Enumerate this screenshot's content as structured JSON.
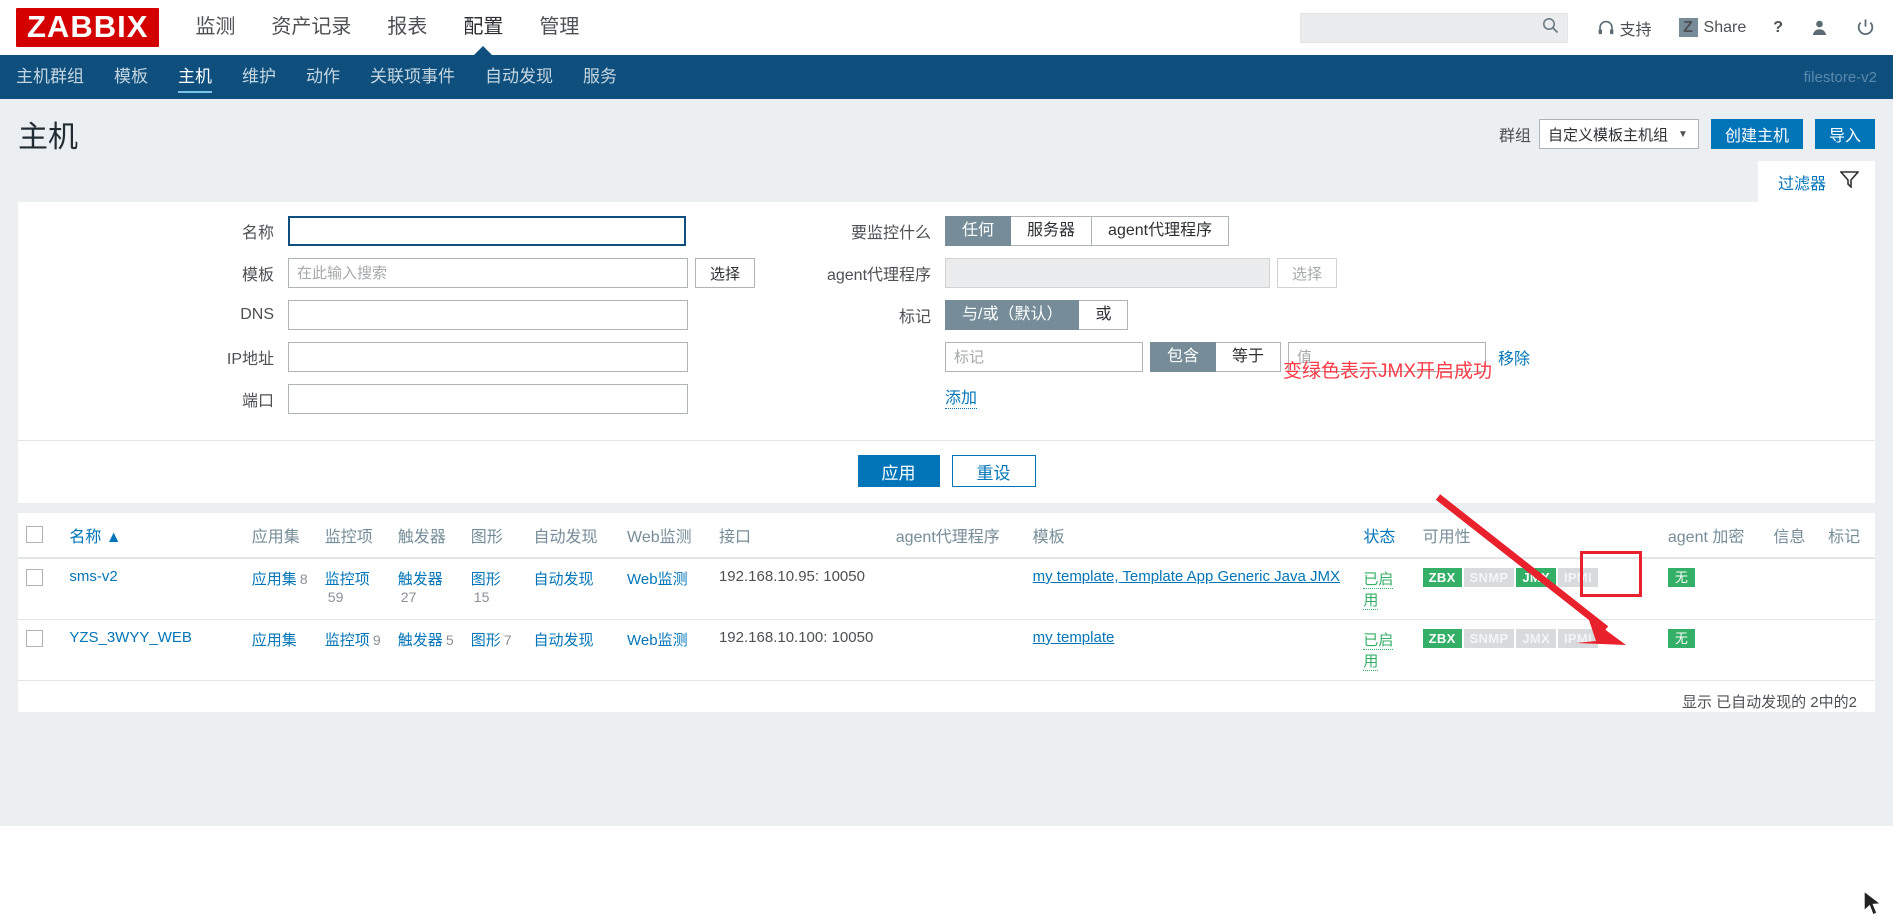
{
  "header": {
    "logo": "ZABBIX",
    "menu": [
      {
        "label": "监测",
        "active": false
      },
      {
        "label": "资产记录",
        "active": false
      },
      {
        "label": "报表",
        "active": false
      },
      {
        "label": "配置",
        "active": true
      },
      {
        "label": "管理",
        "active": false
      }
    ],
    "search_placeholder": "",
    "search_value": "",
    "support_label": "支持",
    "share_label": "Share",
    "share_badge": "Z",
    "help_label": "?"
  },
  "subnav": {
    "items": [
      {
        "label": "主机群组",
        "active": false
      },
      {
        "label": "模板",
        "active": false
      },
      {
        "label": "主机",
        "active": true
      },
      {
        "label": "维护",
        "active": false
      },
      {
        "label": "动作",
        "active": false
      },
      {
        "label": "关联项事件",
        "active": false
      },
      {
        "label": "自动发现",
        "active": false
      },
      {
        "label": "服务",
        "active": false
      }
    ],
    "server_name": "filestore-v2"
  },
  "page": {
    "title": "主机",
    "group_label": "群组",
    "group_value": "自定义模板主机组",
    "create_host_label": "创建主机",
    "import_label": "导入"
  },
  "filter": {
    "tab_label": "过滤器",
    "left": {
      "name_label": "名称",
      "name_value": "",
      "template_label": "模板",
      "template_placeholder": "在此输入搜索",
      "template_value": "",
      "template_select_label": "选择",
      "dns_label": "DNS",
      "dns_value": "",
      "ip_label": "IP地址",
      "ip_value": "",
      "port_label": "端口",
      "port_value": ""
    },
    "right": {
      "monitored_by_label": "要监控什么",
      "monitored_by_options": [
        "任何",
        "服务器",
        "agent代理程序"
      ],
      "monitored_by_selected": "任何",
      "proxy_label": "agent代理程序",
      "proxy_value": "",
      "proxy_select_label": "选择",
      "tags_label": "标记",
      "tag_mode_options": [
        "与/或（默认）",
        "或"
      ],
      "tag_mode_selected": "与/或（默认）",
      "tag_name_placeholder": "标记",
      "tag_name_value": "",
      "tag_operator_options": [
        "包含",
        "等于"
      ],
      "tag_operator_selected": "包含",
      "tag_value_placeholder": "值",
      "tag_value_value": "",
      "remove_label": "移除",
      "add_label": "添加"
    },
    "apply_label": "应用",
    "reset_label": "重设"
  },
  "annotation": {
    "text": "变绿色表示JMX开启成功",
    "color": "#ff3b47"
  },
  "table": {
    "columns": [
      "名称 ▲",
      "应用集",
      "监控项",
      "触发器",
      "图形",
      "自动发现",
      "Web监测",
      "接口",
      "agent代理程序",
      "模板",
      "状态",
      "可用性",
      "agent 加密",
      "信息",
      "标记"
    ],
    "rows": [
      {
        "name": "sms-v2",
        "applications_label": "应用集",
        "applications_count": "8",
        "items_label": "监控项",
        "items_count": "59",
        "triggers_label": "触发器",
        "triggers_count": "27",
        "graphs_label": "图形",
        "graphs_count": "15",
        "discovery_label": "自动发现",
        "web_label": "Web监测",
        "interface": "192.168.10.95: 10050",
        "proxy": "",
        "templates": "my template, Template App Generic Java JMX",
        "status": "已启用",
        "availability": [
          {
            "label": "ZBX",
            "state": "green"
          },
          {
            "label": "SNMP",
            "state": "gray"
          },
          {
            "label": "JMX",
            "state": "green"
          },
          {
            "label": "IPMI",
            "state": "gray"
          }
        ],
        "encryption": "无",
        "info": "",
        "tags": ""
      },
      {
        "name": "YZS_3WYY_WEB",
        "applications_label": "应用集",
        "applications_count": "",
        "items_label": "监控项",
        "items_count": "9",
        "triggers_label": "触发器",
        "triggers_count": "5",
        "graphs_label": "图形",
        "graphs_count": "7",
        "discovery_label": "自动发现",
        "web_label": "Web监测",
        "interface": "192.168.10.100: 10050",
        "proxy": "",
        "templates": "my template",
        "status": "已启用",
        "availability": [
          {
            "label": "ZBX",
            "state": "green"
          },
          {
            "label": "SNMP",
            "state": "gray"
          },
          {
            "label": "JMX",
            "state": "gray"
          },
          {
            "label": "IPMI",
            "state": "gray"
          }
        ],
        "encryption": "无",
        "info": "",
        "tags": ""
      }
    ],
    "footer_count": "显示 已自动发现的 2中的2"
  },
  "colors": {
    "brand_red": "#d40000",
    "nav_blue": "#0e4f7e",
    "accent_blue": "#0275b8",
    "green": "#34af67",
    "gray_badge": "#d7dbde",
    "annotation_red": "#ff3b47"
  }
}
